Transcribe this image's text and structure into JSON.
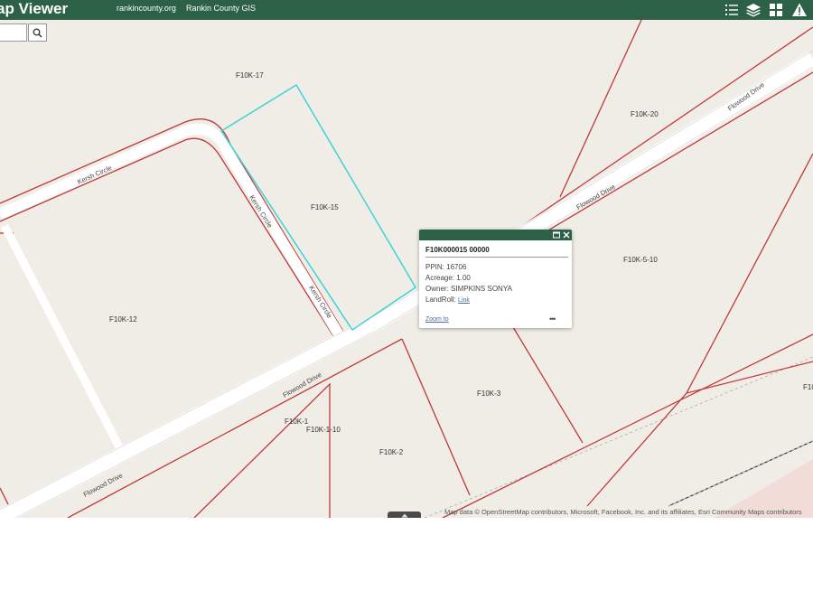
{
  "header": {
    "title": "ap Viewer",
    "link_county": "rankincounty.org",
    "link_gis": "Rankin County GIS",
    "icons": [
      "list-icon",
      "layers-icon",
      "basemap-gallery-icon",
      "warning-icon"
    ],
    "bar_color": "#2d6147"
  },
  "search": {
    "value": "",
    "button_icon": "search-icon"
  },
  "map": {
    "parcels": [
      "F10K-17",
      "F10K-15",
      "F10K-20",
      "F10K-5-10",
      "F10K-12",
      "F10K-3",
      "F10K-1",
      "F10K-1-10",
      "F10K-2",
      "F10"
    ],
    "roads": [
      "Kersh Circle",
      "Kersh Circle",
      "Kersh Circle",
      "Flowood Drive",
      "Flowood Drive",
      "Flowood Drive",
      "Flowood Drive"
    ],
    "selected_parcel": "F10K-15",
    "selection_color": "#3cd3d6",
    "parcel_line_color": "#c0393b"
  },
  "popup": {
    "title": "F10K000015 00000",
    "ppin_label": "PPIN:",
    "ppin": "16706",
    "acreage_label": "Acreage:",
    "acreage": "1.00",
    "owner_label": "Owner:",
    "owner": "SIMPKINS SONYA",
    "landroll_label": "LandRoll:",
    "landroll_link": "Link",
    "zoom_to": "Zoom to",
    "more": "•••"
  },
  "attribution": "Map data © OpenStreetMap contributors, Microsoft, Facebook, Inc. and its affiliates, Esri Community Maps contributors"
}
